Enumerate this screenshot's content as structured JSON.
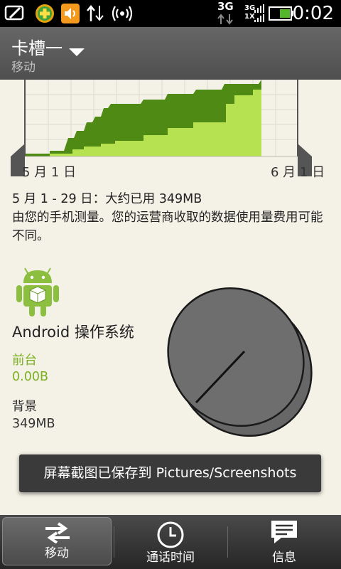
{
  "status_bar": {
    "time": "0:02",
    "network": "3G",
    "signal_labels": [
      "3G",
      "1X"
    ],
    "icons": [
      "edit-icon",
      "plus-app-icon",
      "volume-icon",
      "data-transfer-icon",
      "wireless-icon",
      "signal-icon",
      "battery-icon"
    ]
  },
  "header": {
    "title": "卡槽一",
    "subtitle": "移动"
  },
  "chart": {
    "start_label": "5 月 1 日",
    "end_label": "6 月 1 日"
  },
  "chart_data": {
    "type": "area",
    "title": "",
    "xlabel": "",
    "ylabel": "",
    "x_tick_labels": [
      "5 月 1 日",
      "6 月 1 日"
    ],
    "series": [
      {
        "color": "#4e8a14"
      },
      {
        "color": "#b6e251"
      }
    ]
  },
  "summary": {
    "line1": "5 月 1 - 29 日：大约已用 349MB",
    "line2": "由您的手机测量。您的运营商收取的数据使用量费用可能不同。"
  },
  "app": {
    "name": "Android 操作系统",
    "foreground_label": "前台",
    "foreground_value": "0.00B",
    "background_label": "背景",
    "background_value": "349MB"
  },
  "toast": {
    "text": "屏幕截图已保存到 Pictures/Screenshots"
  },
  "tabs": [
    {
      "label": "移动",
      "icon": "transfer-arrows-icon"
    },
    {
      "label": "通话时间",
      "icon": "clock-icon"
    },
    {
      "label": "信息",
      "icon": "message-icon"
    }
  ],
  "colors": {
    "dark_green": "#4e8a14",
    "light_green": "#b6e251",
    "accent_green": "#7ab020"
  }
}
